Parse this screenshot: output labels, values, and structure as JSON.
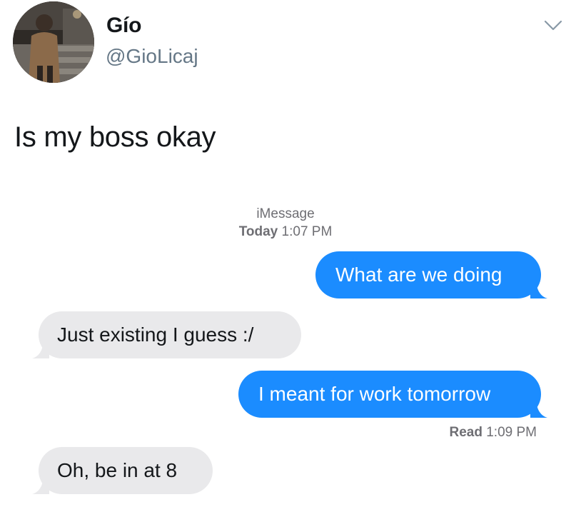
{
  "tweet": {
    "author": {
      "display_name": "Gío",
      "handle": "@GioLicaj",
      "avatar": "profile-photo"
    },
    "text": "Is my boss okay",
    "menu_icon": "chevron-down-icon"
  },
  "conversation": {
    "service": "iMessage",
    "timestamp_day": "Today",
    "timestamp_time": "1:07 PM",
    "messages": [
      {
        "sender": "me",
        "text": "What are we doing"
      },
      {
        "sender": "them",
        "text": "Just existing I guess :/"
      },
      {
        "sender": "me",
        "text": "I meant for work tomorrow"
      },
      {
        "sender": "them",
        "text": "Oh, be in at 8"
      }
    ],
    "read_receipt_label": "Read",
    "read_receipt_time": "1:09 PM"
  },
  "colors": {
    "sent_bubble": "#1b8cff",
    "received_bubble": "#e9e9eb",
    "meta_text": "#6e6e73",
    "handle_text": "#657786"
  }
}
